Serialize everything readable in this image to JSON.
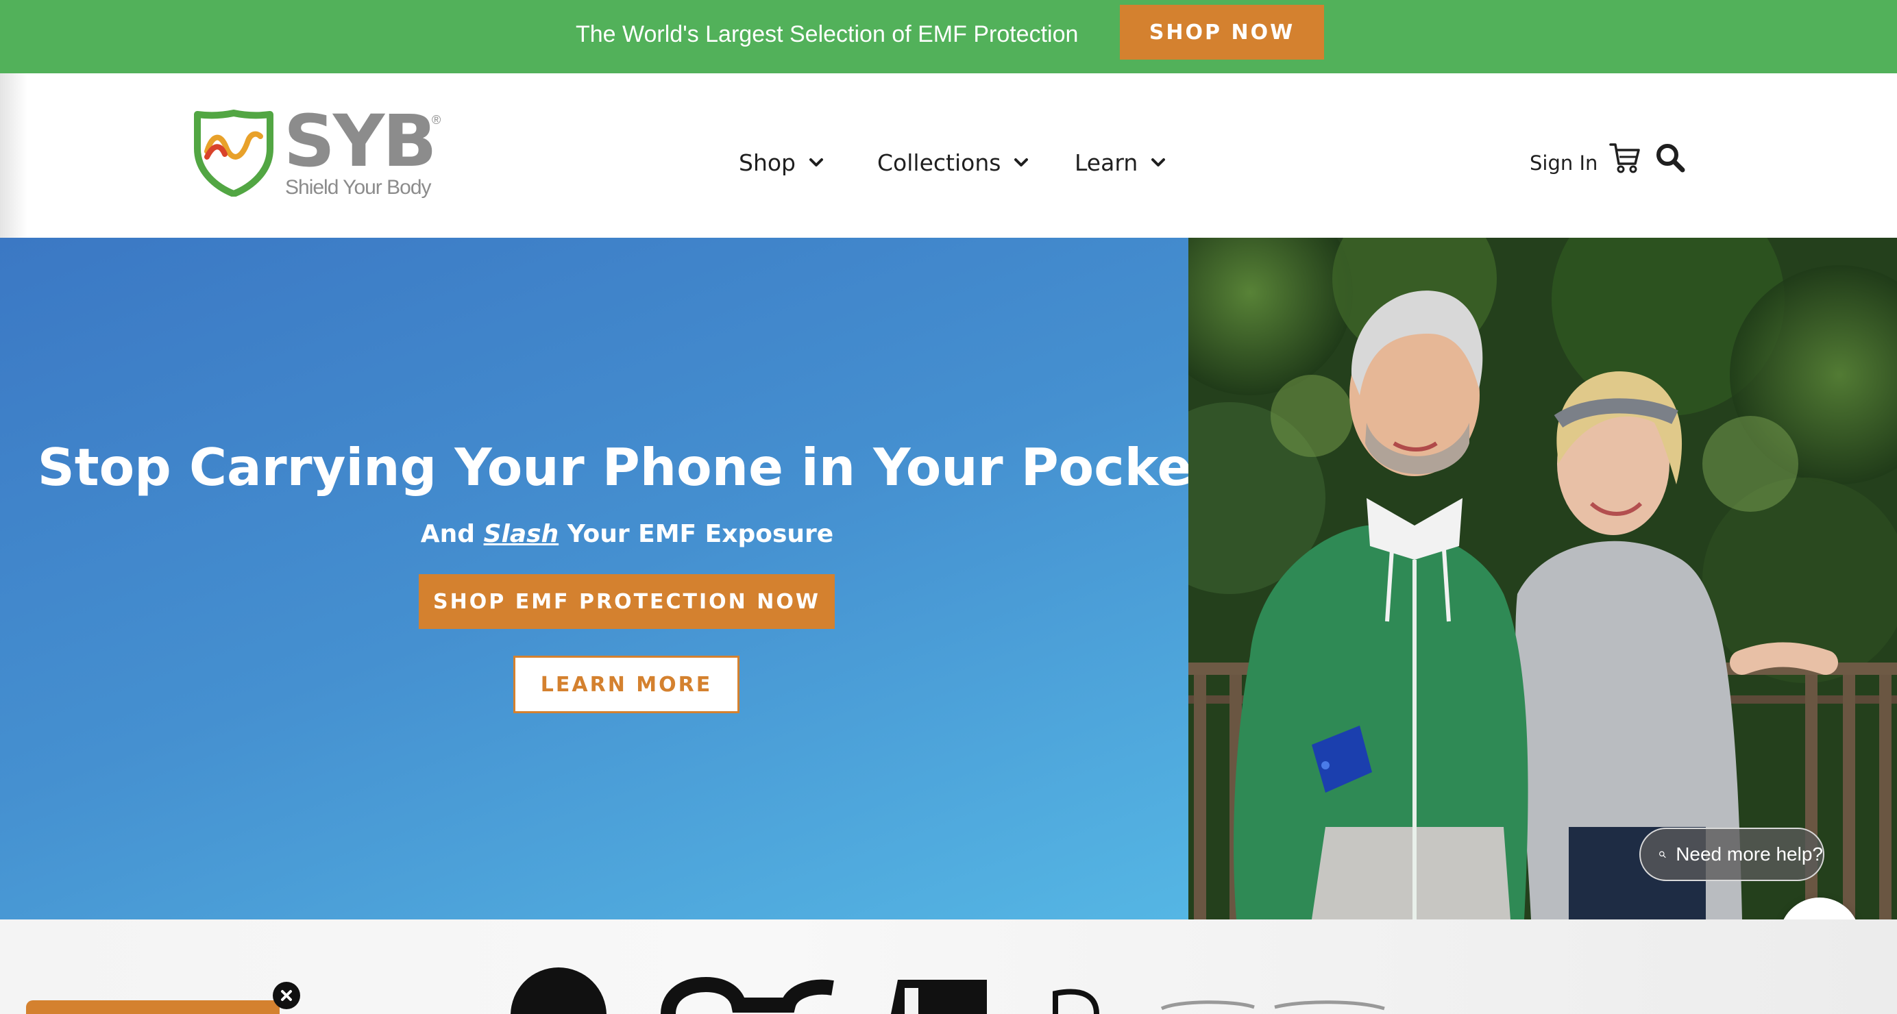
{
  "announcement": {
    "text": "The World's Largest Selection of EMF Protection",
    "button_label": "SHOP NOW"
  },
  "brand": {
    "name": "SYB",
    "registered": "®",
    "tagline": "Shield Your Body",
    "colors": {
      "green": "#52b15a",
      "orange": "#d4812f",
      "gray": "#8c8c8c"
    }
  },
  "nav": {
    "items": [
      {
        "label": "Shop"
      },
      {
        "label": "Collections"
      },
      {
        "label": "Learn"
      }
    ],
    "sign_in": "Sign In",
    "cart_icon": "cart-icon",
    "search_icon": "search-icon"
  },
  "hero": {
    "title": "Stop Carrying Your Phone in Your Pocket",
    "subtitle_before": "And ",
    "subtitle_emphasis": "Slash",
    "subtitle_after": " Your EMF Exposure",
    "cta_label": "SHOP EMF PROTECTION NOW",
    "secondary_label": "LEARN MORE",
    "background_colors": [
      "#3b78c4",
      "#55b6e4"
    ]
  },
  "chat": {
    "help_label": "Need more help?",
    "close_icon": "close-icon"
  }
}
